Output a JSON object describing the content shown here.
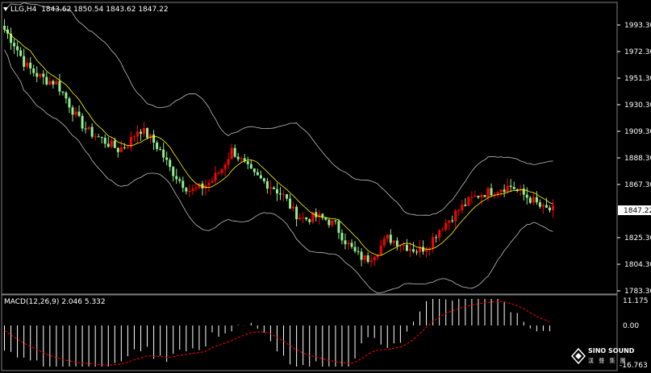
{
  "header": {
    "symbol": "LLG,H4",
    "ohlc": "1843.62 1850.54 1843.62 1847.22"
  },
  "macd": {
    "label": "MACD(12,26,9)",
    "values": "2.046 5.332"
  },
  "price_axis": {
    "ticks": [
      "1993.30",
      "1972.30",
      "1951.30",
      "1930.30",
      "1909.30",
      "1888.30",
      "1867.30",
      "1825.30",
      "1804.30",
      "1783.30"
    ],
    "current_price": "1847.22"
  },
  "macd_axis": {
    "ticks": [
      "11.175",
      "0.00",
      "-16.763"
    ]
  },
  "logo": {
    "name": "SINO SOUND",
    "sub": "漢 聲 集 團"
  },
  "colors": {
    "background": "#000000",
    "bull_candle": "#ff0000",
    "bear_candle": "#90ee90",
    "ma_fast": "#ffff00",
    "bands": "#c0c0c0",
    "macd_hist": "#ffffff",
    "macd_signal": "#ff0000",
    "price_marker": "#ffffff"
  },
  "chart_data": {
    "type": "candlestick",
    "ylim": [
      1783.3,
      1998
    ],
    "close_approx": [
      1990,
      1978,
      1962,
      1955,
      1950,
      1948,
      1935,
      1920,
      1910,
      1905,
      1900,
      1895,
      1900,
      1912,
      1905,
      1895,
      1880,
      1870,
      1862,
      1865,
      1870,
      1880,
      1895,
      1885,
      1875,
      1870,
      1865,
      1858,
      1845,
      1840,
      1842,
      1840,
      1835,
      1822,
      1812,
      1808,
      1815,
      1825,
      1822,
      1818,
      1815,
      1820,
      1832,
      1840,
      1848,
      1855,
      1860,
      1862,
      1865,
      1866,
      1860,
      1855,
      1848,
      1847
    ],
    "macd_ylim": [
      -16.763,
      11.175
    ]
  }
}
